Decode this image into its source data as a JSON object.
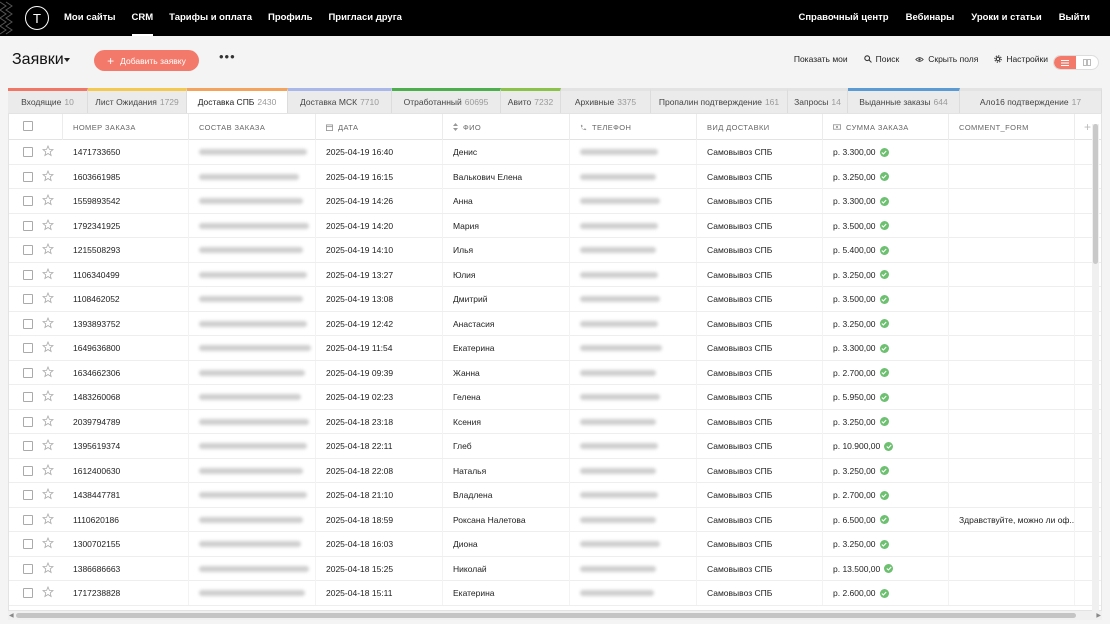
{
  "topbar": {
    "logo": "T",
    "left_items": [
      {
        "label": "Мои сайты",
        "active": false
      },
      {
        "label": "CRM",
        "active": true
      },
      {
        "label": "Тарифы и оплата",
        "active": false
      },
      {
        "label": "Профиль",
        "active": false
      },
      {
        "label": "Пригласи друга",
        "active": false
      }
    ],
    "right_items": [
      {
        "label": "Справочный центр"
      },
      {
        "label": "Вебинары"
      },
      {
        "label": "Уроки и статьи"
      },
      {
        "label": "Выйти"
      }
    ]
  },
  "header": {
    "title": "Заявки",
    "add_button": "Добавить заявку",
    "more": "•••",
    "tools": {
      "show_mine": "Показать мои",
      "search": "Поиск",
      "hide_fields": "Скрыть поля",
      "settings": "Настройки"
    },
    "accent": "#f37a6b"
  },
  "tabs": [
    {
      "label": "Входящие",
      "count": "10",
      "color": "#f07766",
      "active": false
    },
    {
      "label": "Лист Ожидания",
      "count": "1729",
      "color": "#f3c94f",
      "active": false
    },
    {
      "label": "Доставка СПБ",
      "count": "2430",
      "color": "#f2a45e",
      "active": true
    },
    {
      "label": "Доставка МСК",
      "count": "7710",
      "color": "#a9b8e8",
      "active": false
    },
    {
      "label": "Отработанный",
      "count": "60695",
      "color": "#4cae4c",
      "active": false
    },
    {
      "label": "Авито",
      "count": "7232",
      "color": "#8bc34a",
      "active": false
    },
    {
      "label": "Архивные",
      "count": "3375",
      "color": "#e3e3e3",
      "active": false
    },
    {
      "label": "Пропалин подтверждение",
      "count": "161",
      "color": "#e3e3e3",
      "active": false
    },
    {
      "label": "Запросы",
      "count": "14",
      "color": "#e3e3e3",
      "active": false
    },
    {
      "label": "Выданные заказы",
      "count": "644",
      "color": "#5b9bd5",
      "active": false
    },
    {
      "label": "Ало16 подтверждение",
      "count": "17",
      "color": "#e3e3e3",
      "active": false
    }
  ],
  "columns": {
    "order": "НОМЕР ЗАКАЗА",
    "content": "СОСТАВ ЗАКАЗА",
    "date": "ДАТА",
    "name": "ФИО",
    "phone": "ТЕЛЕФОН",
    "delivery": "ВИД ДОСТАВКИ",
    "sum": "СУММА ЗАКАЗА",
    "comment": "COMMENT_FORM",
    "add": "+"
  },
  "rows": [
    {
      "order": "1471733650",
      "date": "2025-04-19 16:40",
      "name": "Денис",
      "delivery": "Самовывоз СПБ",
      "sum": "р. 3.300,00",
      "comment": ""
    },
    {
      "order": "1603661985",
      "date": "2025-04-19 16:15",
      "name": "Валькович Елена",
      "delivery": "Самовывоз СПБ",
      "sum": "р. 3.250,00",
      "comment": ""
    },
    {
      "order": "1559893542",
      "date": "2025-04-19 14:26",
      "name": "Анна",
      "delivery": "Самовывоз СПБ",
      "sum": "р. 3.300,00",
      "comment": ""
    },
    {
      "order": "1792341925",
      "date": "2025-04-19 14:20",
      "name": "Мария",
      "delivery": "Самовывоз СПБ",
      "sum": "р. 3.500,00",
      "comment": ""
    },
    {
      "order": "1215508293",
      "date": "2025-04-19 14:10",
      "name": "Илья",
      "delivery": "Самовывоз СПБ",
      "sum": "р. 5.400,00",
      "comment": ""
    },
    {
      "order": "1106340499",
      "date": "2025-04-19 13:27",
      "name": "Юлия",
      "delivery": "Самовывоз СПБ",
      "sum": "р. 3.250,00",
      "comment": ""
    },
    {
      "order": "1108462052",
      "date": "2025-04-19 13:08",
      "name": "Дмитрий",
      "delivery": "Самовывоз СПБ",
      "sum": "р. 3.500,00",
      "comment": ""
    },
    {
      "order": "1393893752",
      "date": "2025-04-19 12:42",
      "name": "Анастасия",
      "delivery": "Самовывоз СПБ",
      "sum": "р. 3.250,00",
      "comment": ""
    },
    {
      "order": "1649636800",
      "date": "2025-04-19 11:54",
      "name": "Екатерина",
      "delivery": "Самовывоз СПБ",
      "sum": "р. 3.300,00",
      "comment": ""
    },
    {
      "order": "1634662306",
      "date": "2025-04-19 09:39",
      "name": "Жанна",
      "delivery": "Самовывоз СПБ",
      "sum": "р. 2.700,00",
      "comment": ""
    },
    {
      "order": "1483260068",
      "date": "2025-04-19 02:23",
      "name": "Гелена",
      "delivery": "Самовывоз СПБ",
      "sum": "р. 5.950,00",
      "comment": ""
    },
    {
      "order": "2039794789",
      "date": "2025-04-18 23:18",
      "name": "Ксения",
      "delivery": "Самовывоз СПБ",
      "sum": "р. 3.250,00",
      "comment": ""
    },
    {
      "order": "1395619374",
      "date": "2025-04-18 22:11",
      "name": "Глеб",
      "delivery": "Самовывоз СПБ",
      "sum": "р. 10.900,00",
      "comment": ""
    },
    {
      "order": "1612400630",
      "date": "2025-04-18 22:08",
      "name": "Наталья",
      "delivery": "Самовывоз СПБ",
      "sum": "р. 3.250,00",
      "comment": ""
    },
    {
      "order": "1438447781",
      "date": "2025-04-18 21:10",
      "name": "Владлена",
      "delivery": "Самовывоз СПБ",
      "sum": "р. 2.700,00",
      "comment": ""
    },
    {
      "order": "1110620186",
      "date": "2025-04-18 18:59",
      "name": "Роксана Налетова",
      "delivery": "Самовывоз СПБ",
      "sum": "р. 6.500,00",
      "comment": "Здравствуйте, можно ли оф..."
    },
    {
      "order": "1300702155",
      "date": "2025-04-18 16:03",
      "name": "Диона",
      "delivery": "Самовывоз СПБ",
      "sum": "р. 3.250,00",
      "comment": ""
    },
    {
      "order": "1386686663",
      "date": "2025-04-18 15:25",
      "name": "Николай",
      "delivery": "Самовывоз СПБ",
      "sum": "р. 13.500,00",
      "comment": ""
    },
    {
      "order": "1717238828",
      "date": "2025-04-18 15:11",
      "name": "Екатерина",
      "delivery": "Самовывоз СПБ",
      "sum": "р. 2.600,00",
      "comment": ""
    }
  ],
  "status_color": "#6cc070"
}
